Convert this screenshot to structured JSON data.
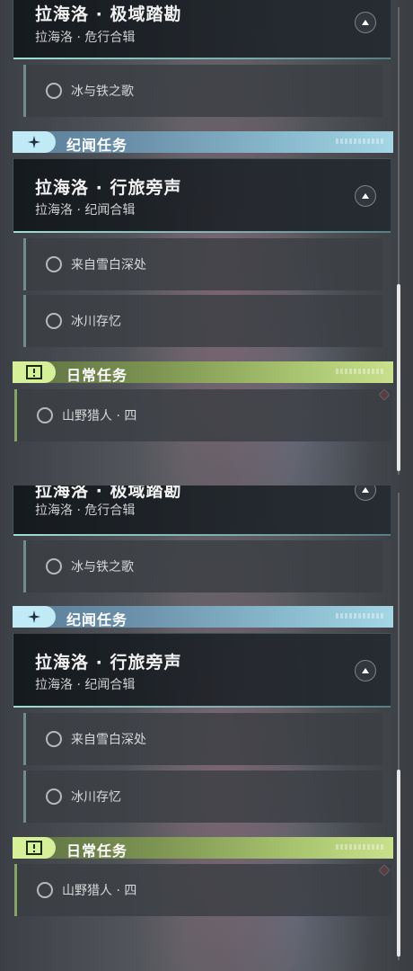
{
  "panels": [
    {
      "quests": [
        {
          "title": "拉海洛 · 极域踏勘",
          "subtitle": "拉海洛 · 危行合辑"
        },
        {
          "title": "拉海洛 · 行旅旁声",
          "subtitle": "拉海洛 · 纪闻合辑"
        }
      ],
      "tasks": {
        "t1": "冰与铁之歌",
        "t2": "来自雪白深处",
        "t3": "冰川存忆",
        "daily": "山野猎人 · 四"
      },
      "categories": {
        "world": "纪闻任务",
        "daily": "日常任务"
      }
    },
    {
      "quests": [
        {
          "title": "拉海洛 · 极域踏勘",
          "subtitle": "拉海洛 · 危行合辑"
        },
        {
          "title": "拉海洛 · 行旅旁声",
          "subtitle": "拉海洛 · 纪闻合辑"
        }
      ],
      "tasks": {
        "t1": "冰与铁之歌",
        "t2": "来自雪白深处",
        "t3": "冰川存忆",
        "daily": "山野猎人 · 四"
      },
      "categories": {
        "world": "纪闻任务",
        "daily": "日常任务"
      }
    }
  ],
  "icons": {
    "collapse": "chevron-up-icon",
    "world_category": "sparkle-icon",
    "daily_category": "alert-square-icon",
    "task_status": "circle-outline-icon",
    "tracked": "red-diamond-icon"
  },
  "colors": {
    "world_accent": "#bfeaf6",
    "daily_accent": "#d6f09a",
    "tracked_marker": "#e0344c"
  }
}
